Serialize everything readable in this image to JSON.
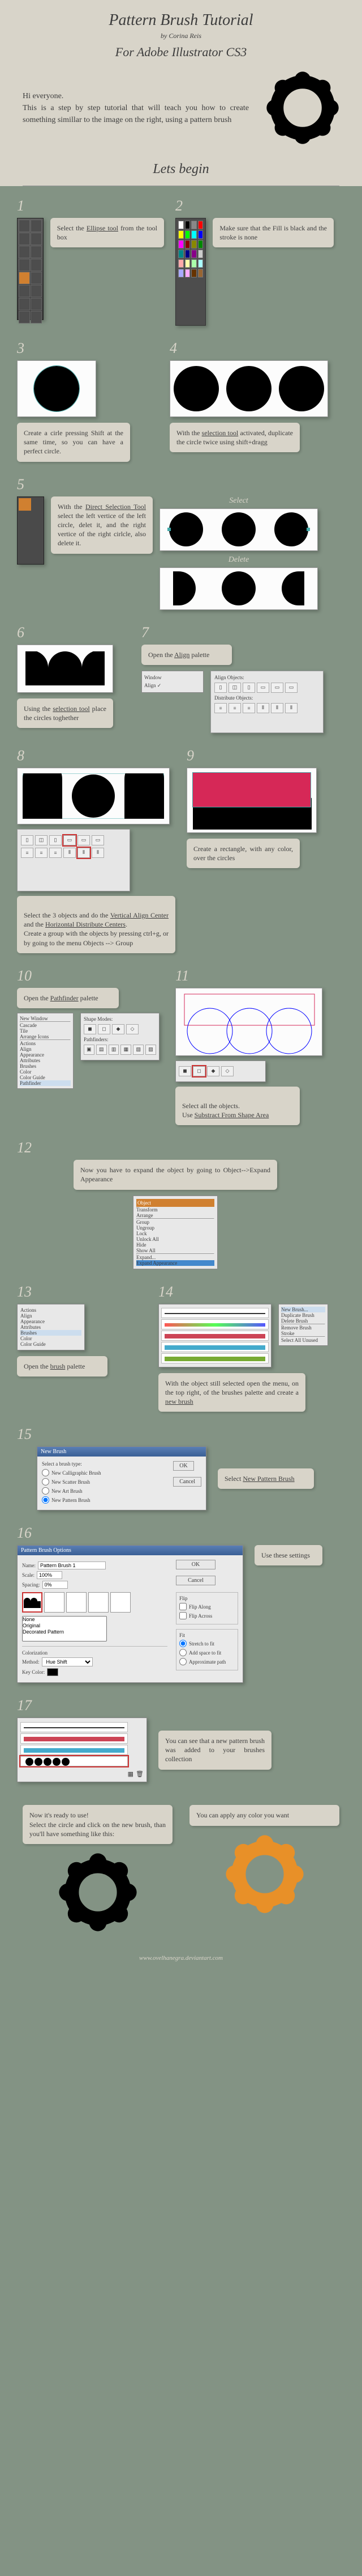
{
  "header": {
    "title": "Pattern Brush Tutorial",
    "author": "by Corina Reis",
    "subtitle": "For Adobe Illustrator CS3"
  },
  "intro": "Hi everyone.\nThis is a step by step tutorial that will teach you how to create something simillar to the image on the right, using a pattern brush",
  "lets_begin": "Lets begin",
  "steps": {
    "s1": {
      "num": "1",
      "caption_pre": "Select the ",
      "caption_u": "Ellipse tool",
      "caption_post": " from the tool box"
    },
    "s2": {
      "num": "2",
      "caption": "Make sure that the Fill is black and the stroke is none"
    },
    "s3": {
      "num": "3",
      "caption": "Create a cirle pressing Shift at the same time, so you can have a perfect circle."
    },
    "s4": {
      "num": "4",
      "caption_pre": "With the ",
      "caption_u": "selection tool",
      "caption_post": " activated, duplicate the circle twice using shift+dragg"
    },
    "s5": {
      "num": "5",
      "caption_pre": "With the ",
      "caption_u": "Direct Selection Tool",
      "caption_post": " select the left vertice of the left circle, delet it, and the right vertice of the right cirlcle, also delete it.",
      "label_select": "Select",
      "label_delete": "Delete"
    },
    "s6": {
      "num": "6",
      "caption_pre": "Using the ",
      "caption_u": "selection tool",
      "caption_post": " place the circles toghether"
    },
    "s7": {
      "num": "7",
      "caption_pre": "Open the ",
      "caption_u": "Align",
      "caption_post": " palette",
      "align_header": "Align Objects:",
      "dist_header": "Distribute Objects:"
    },
    "s8": {
      "num": "8",
      "caption_pre": "Select the 3 objects and do the ",
      "caption_u1": "Vertical Align Center",
      "caption_mid": " and the ",
      "caption_u2": "Horizontal Distribute Centers",
      "caption_post": ".\nCreate a group with the objects by pressing ctrl+g, or by going to the menu Objects --> Group"
    },
    "s9": {
      "num": "9",
      "caption": "Create a rectangle, with any color, over the circles"
    },
    "s10": {
      "num": "10",
      "caption_pre": "Open the ",
      "caption_u": "Pathfinder",
      "caption_post": " palette",
      "menu_items": [
        "New Window",
        "Cascade",
        "Tile",
        "Arrange Icons",
        "Actions",
        "Align",
        "Appearance",
        "Attributes",
        "Brushes",
        "Color",
        "Color Guide",
        "Pathfinder"
      ],
      "pf_label": "Shape Modes:",
      "pf_label2": "Pathfinders:"
    },
    "s11": {
      "num": "11",
      "caption_pre": "Select all the objects.\nUse ",
      "caption_u": "Substract From Shape Area"
    },
    "s12": {
      "num": "12",
      "caption": "Now you have to expand the object by going to Object-->Expand Appearance",
      "menu_title": "Object",
      "menu_items": [
        "Transform",
        "Arrange",
        "Group",
        "Ungroup",
        "Lock",
        "Unlock All",
        "Hide",
        "Show All",
        "Expand...",
        "Expand Appearance"
      ]
    },
    "s13": {
      "num": "13",
      "caption_pre": "Open the ",
      "caption_u": "brush",
      "caption_post": " palette",
      "menu_items": [
        "Actions",
        "Align",
        "Appearance",
        "Attributes",
        "Brushes",
        "Color",
        "Color Guide"
      ]
    },
    "s14": {
      "num": "14",
      "caption_pre": "With the object still selected open the menu, on the top right, of the brushes palette and create a ",
      "caption_u": "new brush",
      "menu_items": [
        "New Brush...",
        "Duplicate Brush",
        "Delete Brush",
        "Remove Brush Stroke",
        "Select All Unused"
      ]
    },
    "s15": {
      "num": "15",
      "caption_pre": "Select ",
      "caption_u": "New Pattern Brush",
      "title": "New Brush",
      "opt_label": "Select a brush type:",
      "opts": [
        "New Calligraphic Brush",
        "New Scatter Brush",
        "New Art Brush",
        "New Pattern Brush"
      ],
      "ok": "OK",
      "cancel": "Cancel"
    },
    "s16": {
      "num": "16",
      "caption": "Use these settings",
      "title": "Pattern Brush Options",
      "name_label": "Name:",
      "name_val": "Pattern Brush 1",
      "scale_label": "Scale:",
      "scale_val": "100%",
      "spacing_label": "Spacing:",
      "spacing_val": "0%",
      "flip_label": "Flip",
      "flip_a": "Flip Along",
      "flip_x": "Flip Across",
      "fit_label": "Fit",
      "fit_opts": [
        "Stretch to fit",
        "Add space to fit",
        "Approximate path"
      ],
      "color_label": "Colorization",
      "method_label": "Method:",
      "method_val": "Hue Shift",
      "keycolor": "Key Color:",
      "list_items": [
        "None",
        "Original",
        "Decorated Pattern"
      ],
      "ok": "OK",
      "cancel": "Cancel"
    },
    "s17": {
      "num": "17",
      "caption": "You can see that a new pattern brush was added to your brushes collection"
    }
  },
  "footer": {
    "left": "Now it's ready to use!\nSelect the circle and click on the new brush, than you'll have something like this:",
    "right": "You can apply any color you want"
  },
  "url": "www.ovelhanegra.deviantart.com"
}
